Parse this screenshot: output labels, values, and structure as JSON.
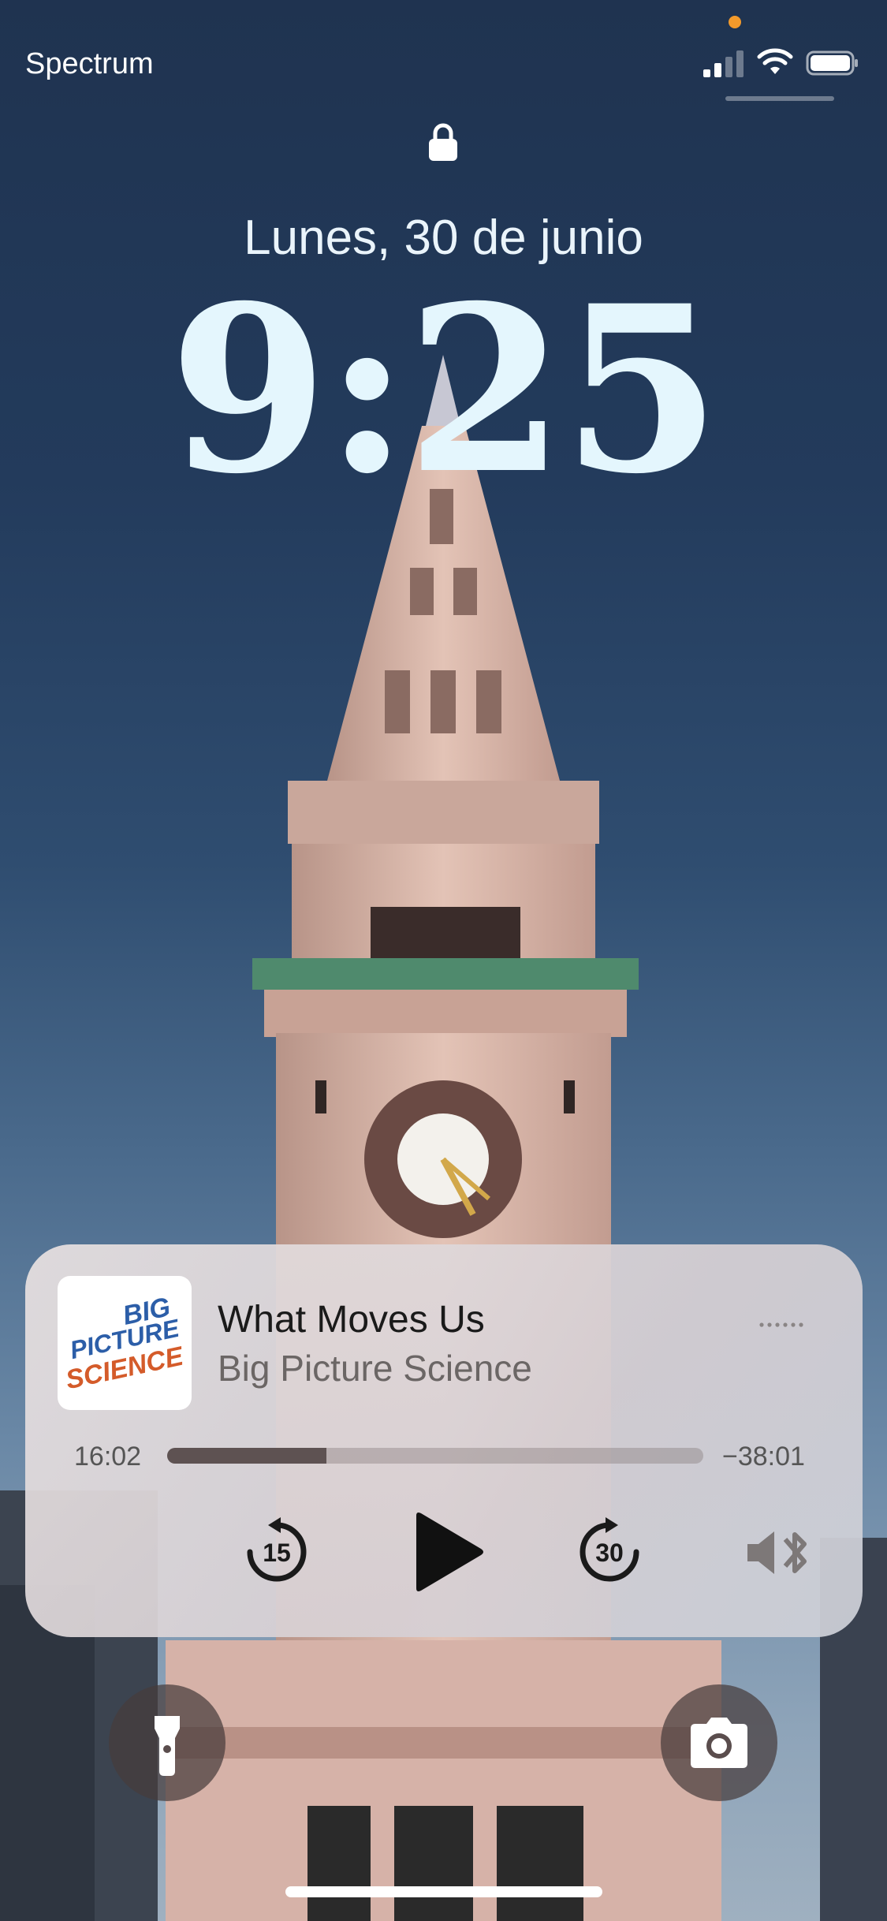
{
  "status_bar": {
    "carrier": "Spectrum",
    "signal_icon": "signal-bars-icon",
    "wifi_icon": "wifi-icon",
    "battery_icon": "battery-icon",
    "privacy_dot_color": "#f39a2b"
  },
  "lock_screen": {
    "lock_icon": "lock-icon",
    "date": "Lunes, 30 de junio",
    "time": "9:25"
  },
  "now_playing": {
    "title": "What Moves Us",
    "artist": "Big Picture Science",
    "artwork_text": [
      "BIG",
      "PICTURE",
      "SCIENCE"
    ],
    "elapsed": "16:02",
    "remaining": "−38:01",
    "progress_fraction": 0.297,
    "skip_back_seconds": "15",
    "skip_forward_seconds": "30",
    "controls": {
      "more_icon": "more-dots-icon",
      "skip_back_icon": "skip-back-15-icon",
      "play_icon": "play-icon",
      "skip_forward_icon": "skip-forward-30-icon",
      "audio_route_icon": "speaker-bluetooth-icon"
    }
  },
  "quick_actions": {
    "flashlight_icon": "flashlight-icon",
    "camera_icon": "camera-icon"
  }
}
